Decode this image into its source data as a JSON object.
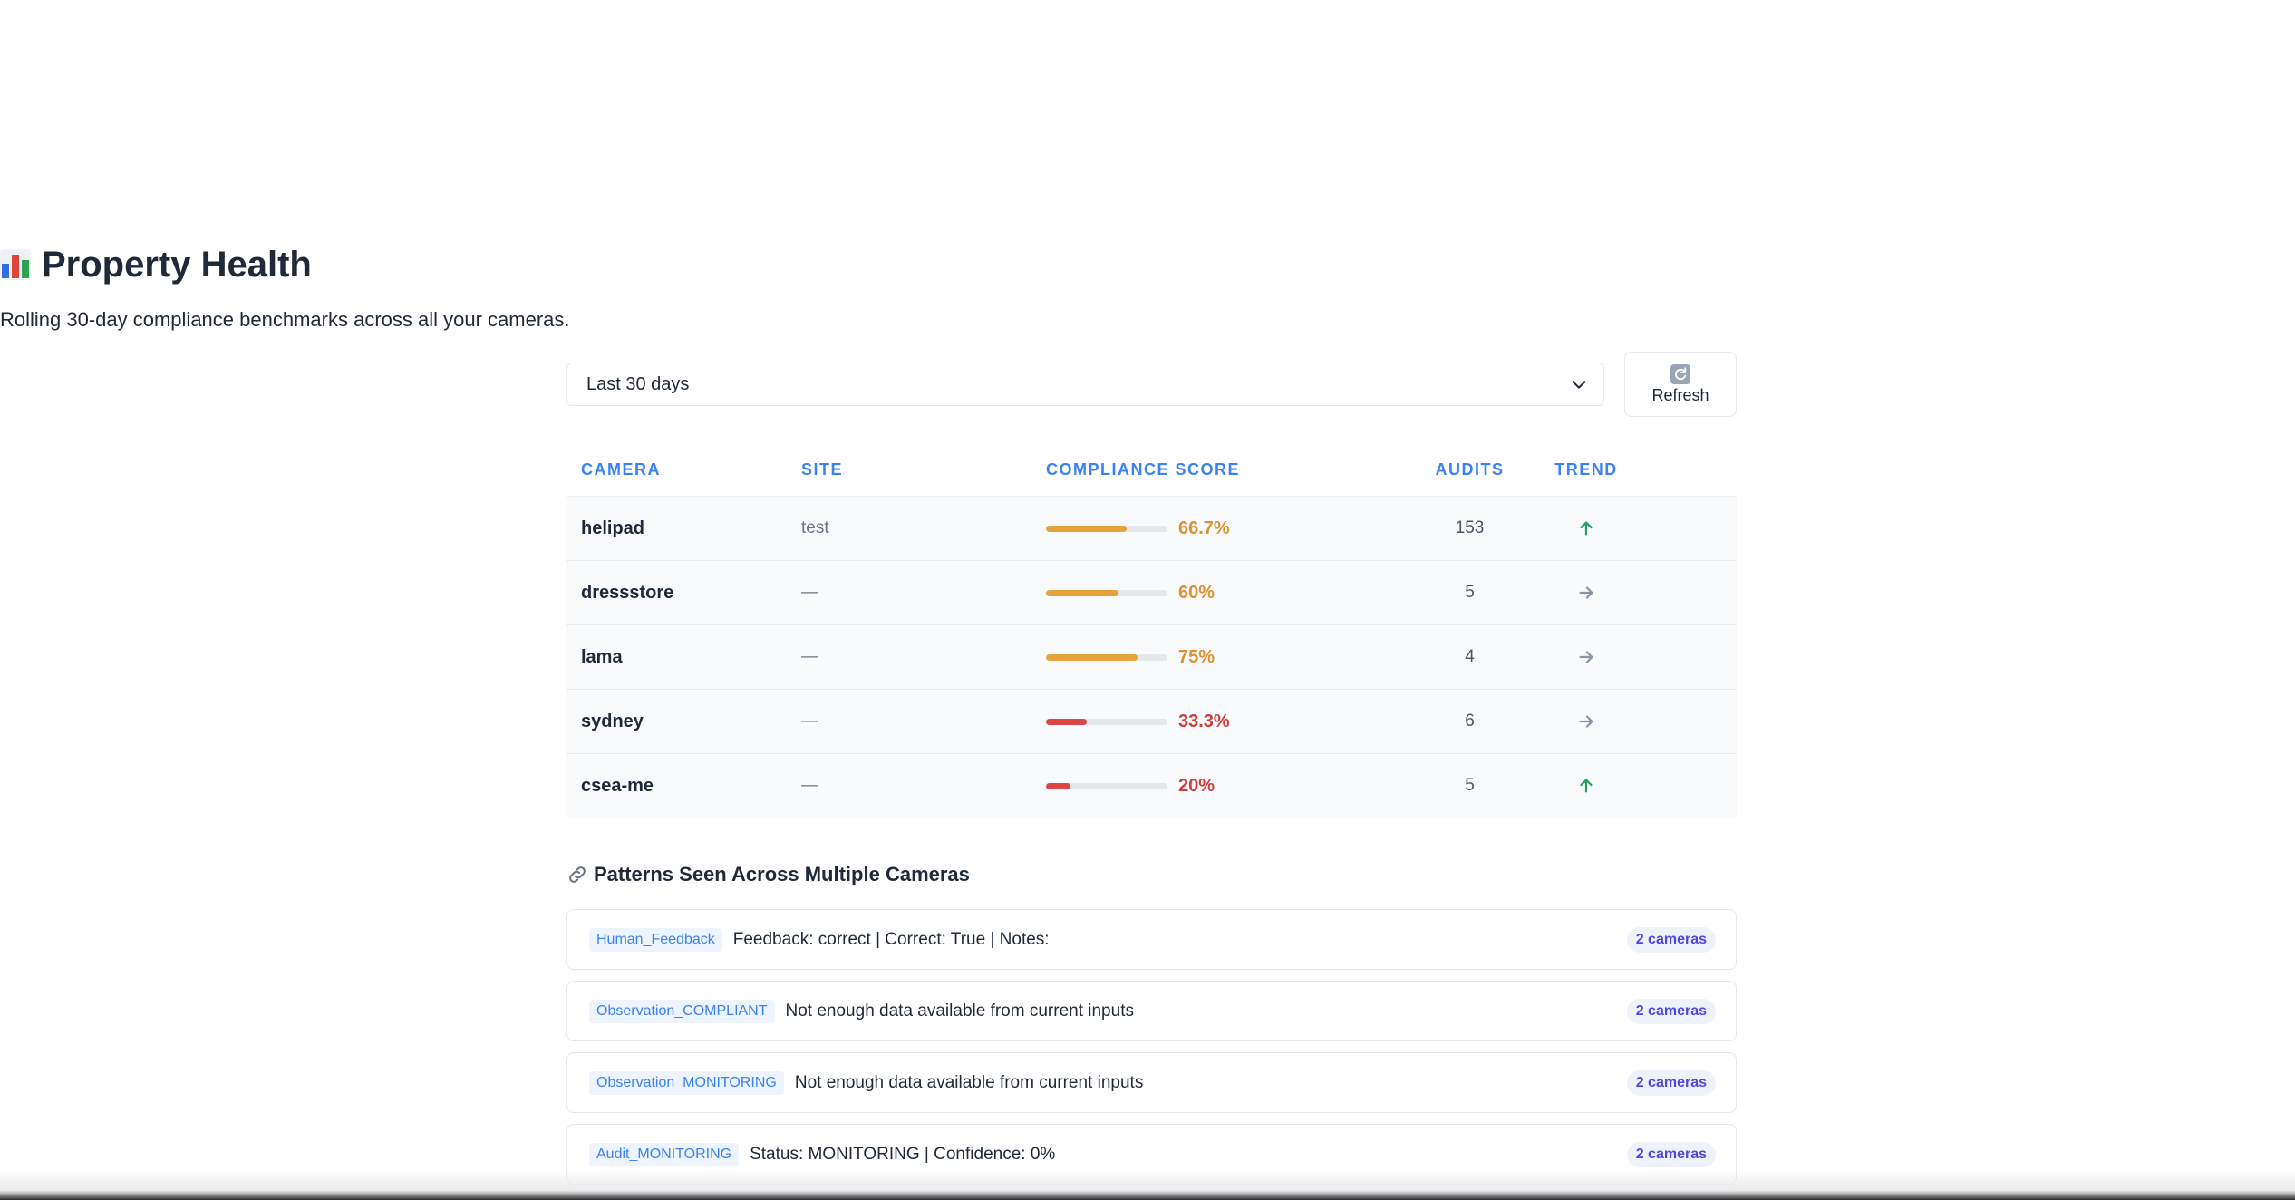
{
  "page": {
    "title": "Property Health",
    "subtitle": "Rolling 30-day compliance benchmarks across all your cameras."
  },
  "filters": {
    "range_selected": "Last 30 days",
    "refresh_label": "Refresh"
  },
  "table": {
    "headers": {
      "camera": "CAMERA",
      "site": "SITE",
      "score": "COMPLIANCE SCORE",
      "audits": "AUDITS",
      "trend": "TREND"
    },
    "rows": [
      {
        "camera": "helipad",
        "site": "test",
        "score": "66.7%",
        "score_fraction": 0.667,
        "level": "warn",
        "audits": "153",
        "trend": "up-arrow-icon"
      },
      {
        "camera": "dressstore",
        "site": "—",
        "score": "60%",
        "score_fraction": 0.6,
        "level": "warn",
        "audits": "5",
        "trend": "right-arrow-icon"
      },
      {
        "camera": "lama",
        "site": "—",
        "score": "75%",
        "score_fraction": 0.75,
        "level": "warn",
        "audits": "4",
        "trend": "right-arrow-icon"
      },
      {
        "camera": "sydney",
        "site": "—",
        "score": "33.3%",
        "score_fraction": 0.333,
        "level": "bad",
        "audits": "6",
        "trend": "right-arrow-icon"
      },
      {
        "camera": "csea-me",
        "site": "—",
        "score": "20%",
        "score_fraction": 0.2,
        "level": "bad",
        "audits": "5",
        "trend": "up-arrow-icon"
      }
    ]
  },
  "patterns": {
    "title": "Patterns Seen Across Multiple Cameras",
    "items": [
      {
        "tag": "Human_Feedback",
        "text": "Feedback: correct | Correct: True | Notes:",
        "count": "2 cameras"
      },
      {
        "tag": "Observation_COMPLIANT",
        "text": "Not enough data available from current inputs",
        "count": "2 cameras"
      },
      {
        "tag": "Observation_MONITORING",
        "text": "Not enough data available from current inputs",
        "count": "2 cameras"
      },
      {
        "tag": "Audit_MONITORING",
        "text": "Status: MONITORING | Confidence: 0%",
        "count": "2 cameras"
      }
    ]
  },
  "colors": {
    "warn": "#e8a23a",
    "warn_text": "#e0912f",
    "bad": "#dc4545",
    "bad_text": "#d33b3b",
    "trend_up": "#22a35a",
    "trend_flat": "#8a94a6",
    "accent": "#3b82f6"
  }
}
